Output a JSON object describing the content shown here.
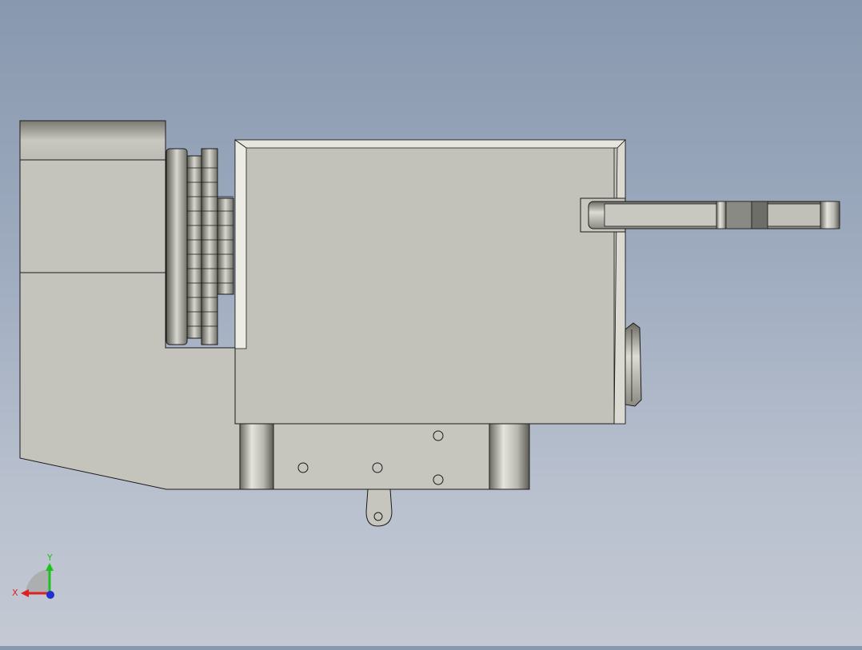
{
  "viewport": {
    "view": "front",
    "background_top": "#8898ae",
    "background_bottom": "#c4c9d3"
  },
  "model": {
    "body_fill": "#c4c4bc",
    "outline_color": "#1a1a1a",
    "cylinder_dark": "#707068",
    "cylinder_light": "#e0e0d8"
  },
  "triad": {
    "x_label": "X",
    "y_label": "Y",
    "x_color": "#e02020",
    "y_color": "#20c020",
    "z_color": "#2030d0"
  }
}
